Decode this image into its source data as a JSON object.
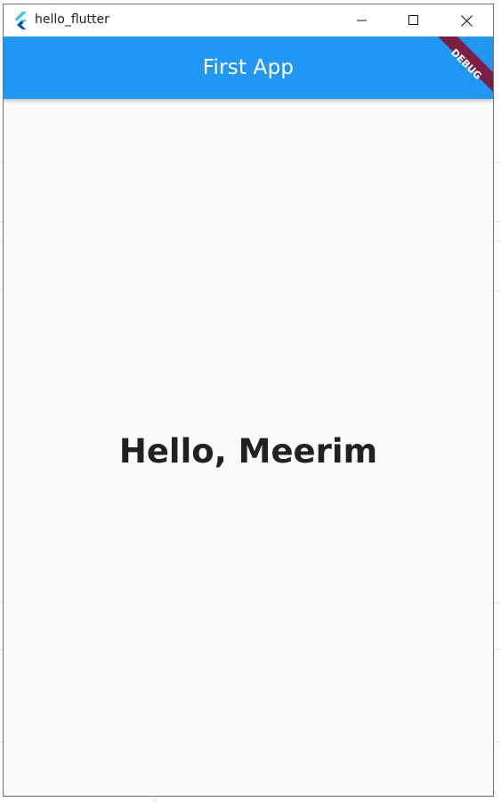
{
  "window": {
    "title": "hello_flutter",
    "icon": "flutter-logo-icon"
  },
  "controls": {
    "minimize_icon": "minimize-icon",
    "maximize_icon": "maximize-icon",
    "close_icon": "close-icon"
  },
  "appbar": {
    "title": "First App",
    "color": "#2196f3"
  },
  "debug_banner": {
    "label": "DEBUG",
    "color": "#7b1f47"
  },
  "body": {
    "greeting": "Hello, Meerim"
  }
}
